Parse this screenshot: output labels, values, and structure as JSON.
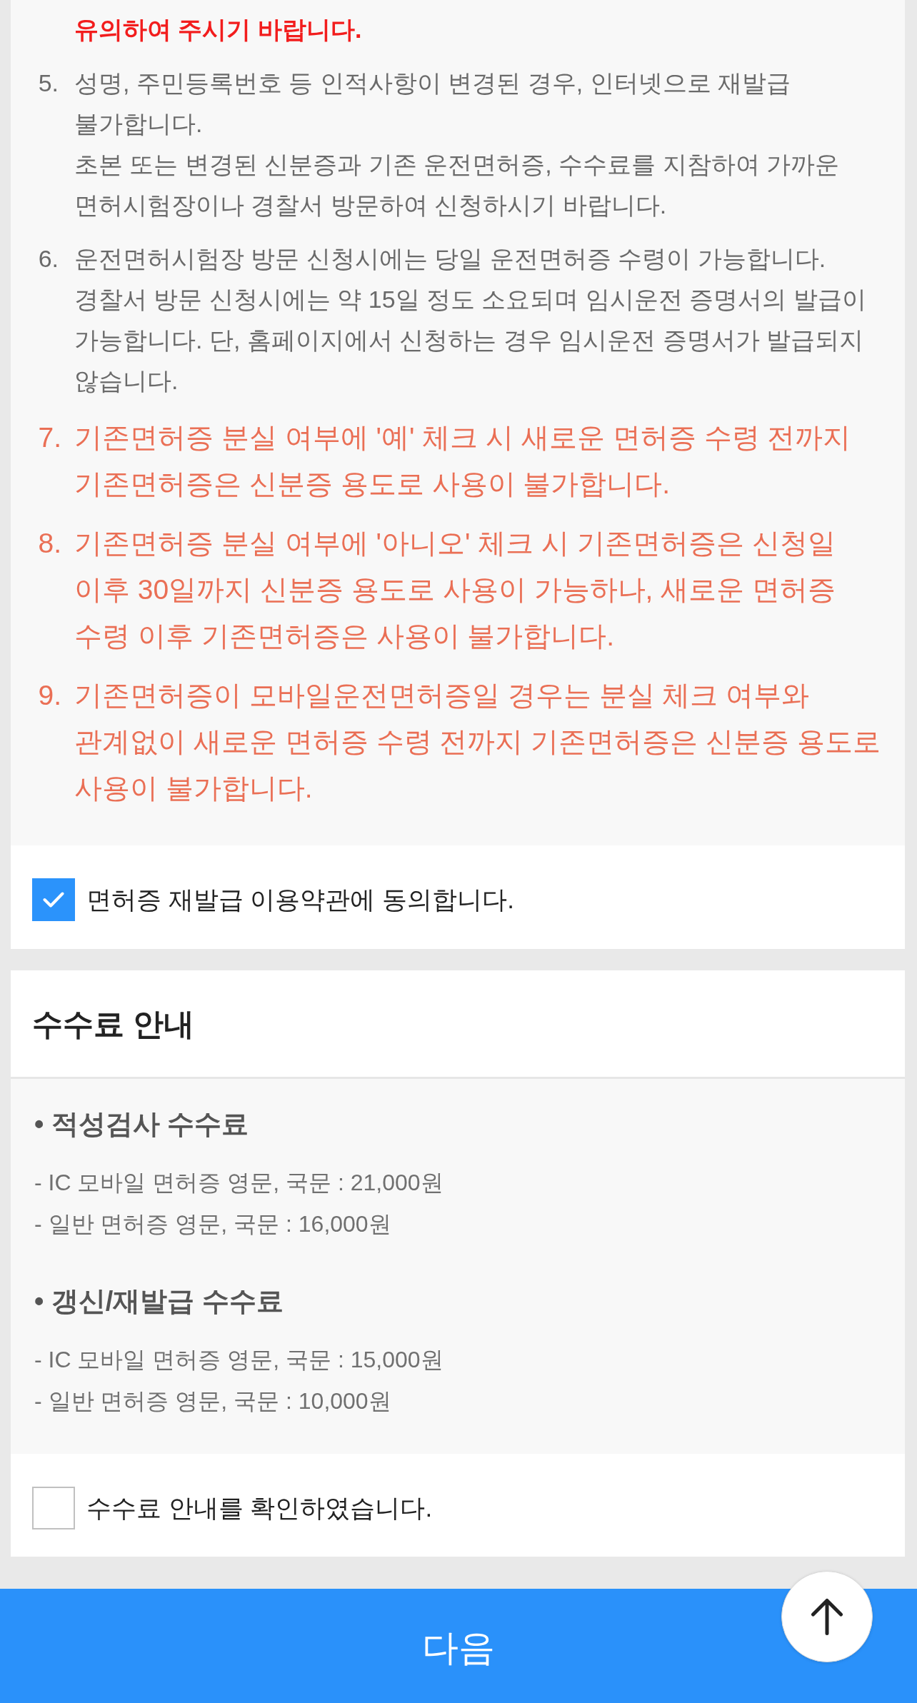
{
  "notice_items": [
    {
      "kind": "continued",
      "paragraphs": [
        "유의하여 주시기 바랍니다."
      ]
    },
    {
      "kind": "normal",
      "number": "5.",
      "paragraphs": [
        "성명, 주민등록번호 등 인적사항이 변경된 경우, 인터넷으로 재발급 불가합니다.",
        "초본 또는 변경된 신분증과 기존 운전면허증, 수수료를 지참하여 가까운 면허시험장이나 경찰서 방문하여 신청하시기 바랍니다."
      ]
    },
    {
      "kind": "normal",
      "number": "6.",
      "paragraphs": [
        "운전면허시험장 방문 신청시에는 당일 운전면허증 수령이 가능합니다.",
        "경찰서 방문 신청시에는 약 15일 정도 소요되며 임시운전 증명서의 발급이 가능합니다. 단, 홈페이지에서 신청하는 경우 임시운전 증명서가 발급되지 않습니다."
      ]
    },
    {
      "kind": "warning",
      "number": "7.",
      "paragraphs": [
        "기존면허증 분실 여부에 '예' 체크 시 새로운 면허증 수령 전까지 기존면허증은 신분증 용도로 사용이 불가합니다."
      ]
    },
    {
      "kind": "warning",
      "number": "8.",
      "paragraphs": [
        "기존면허증 분실 여부에 '아니오' 체크 시 기존면허증은 신청일 이후 30일까지 신분증 용도로 사용이 가능하나, 새로운 면허증 수령 이후 기존면허증은 사용이 불가합니다."
      ]
    },
    {
      "kind": "warning",
      "number": "9.",
      "paragraphs": [
        "기존면허증이 모바일운전면허증일 경우는 분실 체크 여부와 관계없이 새로운 면허증 수령 전까지 기존면허증은 신분증 용도로 사용이 불가합니다."
      ]
    }
  ],
  "terms_agreement": {
    "label": "면허증 재발급 이용약관에 동의합니다.",
    "checked": true
  },
  "fee_info": {
    "title": "수수료 안내",
    "groups": [
      {
        "heading": "• 적성검사 수수료",
        "lines": [
          "- IC 모바일 면허증 영문, 국문 : 21,000원",
          "- 일반 면허증 영문, 국문 : 16,000원"
        ]
      },
      {
        "heading": "• 갱신/재발급 수수료",
        "lines": [
          "- IC 모바일 면허증 영문, 국문 : 15,000원",
          "- 일반 면허증 영문, 국문 : 10,000원"
        ]
      }
    ],
    "confirmation": {
      "label": "수수료 안내를 확인하였습니다.",
      "checked": false
    }
  },
  "next_button": {
    "label": "다음"
  }
}
